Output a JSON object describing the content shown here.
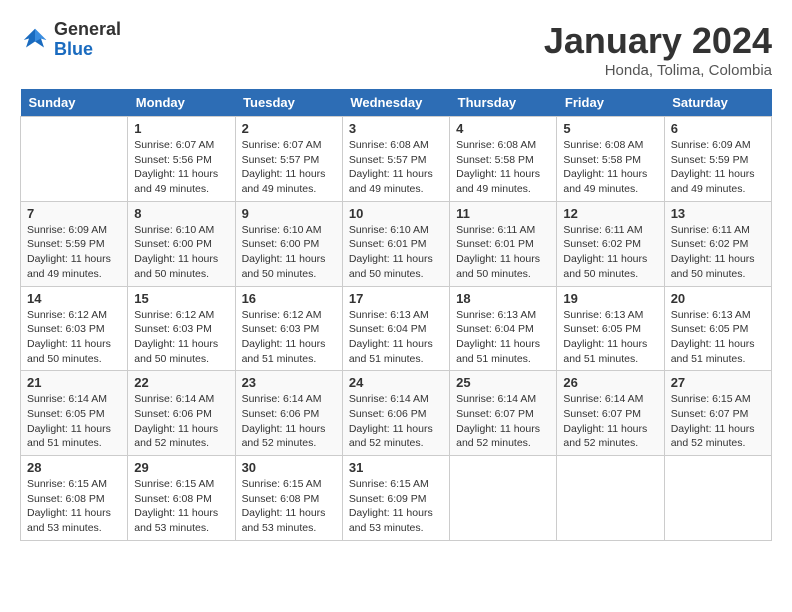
{
  "header": {
    "logo_general": "General",
    "logo_blue": "Blue",
    "month_title": "January 2024",
    "location": "Honda, Tolima, Colombia"
  },
  "days_of_week": [
    "Sunday",
    "Monday",
    "Tuesday",
    "Wednesday",
    "Thursday",
    "Friday",
    "Saturday"
  ],
  "weeks": [
    [
      {
        "day": "",
        "info": ""
      },
      {
        "day": "1",
        "info": "Sunrise: 6:07 AM\nSunset: 5:56 PM\nDaylight: 11 hours\nand 49 minutes."
      },
      {
        "day": "2",
        "info": "Sunrise: 6:07 AM\nSunset: 5:57 PM\nDaylight: 11 hours\nand 49 minutes."
      },
      {
        "day": "3",
        "info": "Sunrise: 6:08 AM\nSunset: 5:57 PM\nDaylight: 11 hours\nand 49 minutes."
      },
      {
        "day": "4",
        "info": "Sunrise: 6:08 AM\nSunset: 5:58 PM\nDaylight: 11 hours\nand 49 minutes."
      },
      {
        "day": "5",
        "info": "Sunrise: 6:08 AM\nSunset: 5:58 PM\nDaylight: 11 hours\nand 49 minutes."
      },
      {
        "day": "6",
        "info": "Sunrise: 6:09 AM\nSunset: 5:59 PM\nDaylight: 11 hours\nand 49 minutes."
      }
    ],
    [
      {
        "day": "7",
        "info": "Sunrise: 6:09 AM\nSunset: 5:59 PM\nDaylight: 11 hours\nand 49 minutes."
      },
      {
        "day": "8",
        "info": "Sunrise: 6:10 AM\nSunset: 6:00 PM\nDaylight: 11 hours\nand 50 minutes."
      },
      {
        "day": "9",
        "info": "Sunrise: 6:10 AM\nSunset: 6:00 PM\nDaylight: 11 hours\nand 50 minutes."
      },
      {
        "day": "10",
        "info": "Sunrise: 6:10 AM\nSunset: 6:01 PM\nDaylight: 11 hours\nand 50 minutes."
      },
      {
        "day": "11",
        "info": "Sunrise: 6:11 AM\nSunset: 6:01 PM\nDaylight: 11 hours\nand 50 minutes."
      },
      {
        "day": "12",
        "info": "Sunrise: 6:11 AM\nSunset: 6:02 PM\nDaylight: 11 hours\nand 50 minutes."
      },
      {
        "day": "13",
        "info": "Sunrise: 6:11 AM\nSunset: 6:02 PM\nDaylight: 11 hours\nand 50 minutes."
      }
    ],
    [
      {
        "day": "14",
        "info": "Sunrise: 6:12 AM\nSunset: 6:03 PM\nDaylight: 11 hours\nand 50 minutes."
      },
      {
        "day": "15",
        "info": "Sunrise: 6:12 AM\nSunset: 6:03 PM\nDaylight: 11 hours\nand 50 minutes."
      },
      {
        "day": "16",
        "info": "Sunrise: 6:12 AM\nSunset: 6:03 PM\nDaylight: 11 hours\nand 51 minutes."
      },
      {
        "day": "17",
        "info": "Sunrise: 6:13 AM\nSunset: 6:04 PM\nDaylight: 11 hours\nand 51 minutes."
      },
      {
        "day": "18",
        "info": "Sunrise: 6:13 AM\nSunset: 6:04 PM\nDaylight: 11 hours\nand 51 minutes."
      },
      {
        "day": "19",
        "info": "Sunrise: 6:13 AM\nSunset: 6:05 PM\nDaylight: 11 hours\nand 51 minutes."
      },
      {
        "day": "20",
        "info": "Sunrise: 6:13 AM\nSunset: 6:05 PM\nDaylight: 11 hours\nand 51 minutes."
      }
    ],
    [
      {
        "day": "21",
        "info": "Sunrise: 6:14 AM\nSunset: 6:05 PM\nDaylight: 11 hours\nand 51 minutes."
      },
      {
        "day": "22",
        "info": "Sunrise: 6:14 AM\nSunset: 6:06 PM\nDaylight: 11 hours\nand 52 minutes."
      },
      {
        "day": "23",
        "info": "Sunrise: 6:14 AM\nSunset: 6:06 PM\nDaylight: 11 hours\nand 52 minutes."
      },
      {
        "day": "24",
        "info": "Sunrise: 6:14 AM\nSunset: 6:06 PM\nDaylight: 11 hours\nand 52 minutes."
      },
      {
        "day": "25",
        "info": "Sunrise: 6:14 AM\nSunset: 6:07 PM\nDaylight: 11 hours\nand 52 minutes."
      },
      {
        "day": "26",
        "info": "Sunrise: 6:14 AM\nSunset: 6:07 PM\nDaylight: 11 hours\nand 52 minutes."
      },
      {
        "day": "27",
        "info": "Sunrise: 6:15 AM\nSunset: 6:07 PM\nDaylight: 11 hours\nand 52 minutes."
      }
    ],
    [
      {
        "day": "28",
        "info": "Sunrise: 6:15 AM\nSunset: 6:08 PM\nDaylight: 11 hours\nand 53 minutes."
      },
      {
        "day": "29",
        "info": "Sunrise: 6:15 AM\nSunset: 6:08 PM\nDaylight: 11 hours\nand 53 minutes."
      },
      {
        "day": "30",
        "info": "Sunrise: 6:15 AM\nSunset: 6:08 PM\nDaylight: 11 hours\nand 53 minutes."
      },
      {
        "day": "31",
        "info": "Sunrise: 6:15 AM\nSunset: 6:09 PM\nDaylight: 11 hours\nand 53 minutes."
      },
      {
        "day": "",
        "info": ""
      },
      {
        "day": "",
        "info": ""
      },
      {
        "day": "",
        "info": ""
      }
    ]
  ]
}
